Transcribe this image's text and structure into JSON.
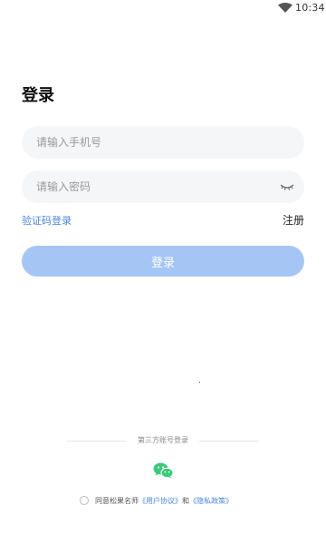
{
  "status_bar": {
    "time": "10:34",
    "wifi_icon": "wifi-icon"
  },
  "login_page": {
    "title": "登录",
    "phone_placeholder": "请输入手机号",
    "password_placeholder": "请输入密码",
    "password_toggle_icon": "eye-closed-icon",
    "sms_login_label": "验证码登录",
    "register_label": "注册",
    "login_button_label": "登录",
    "login_button_state": "disabled",
    "third_party_label": "第三方账号登录",
    "wechat_icon": "wechat-icon",
    "agreement_prefix": "同意松果名师",
    "user_agreement_link": "《用户协议》",
    "agreement_and": "和",
    "privacy_policy_link": "《隐私政策》",
    "agreement_checked": false
  },
  "colors": {
    "accent": "#4a86d8",
    "button_disabled": "#a5c6f4",
    "input_bg": "#f5f6f7",
    "wechat_green": "#3ec87b"
  }
}
